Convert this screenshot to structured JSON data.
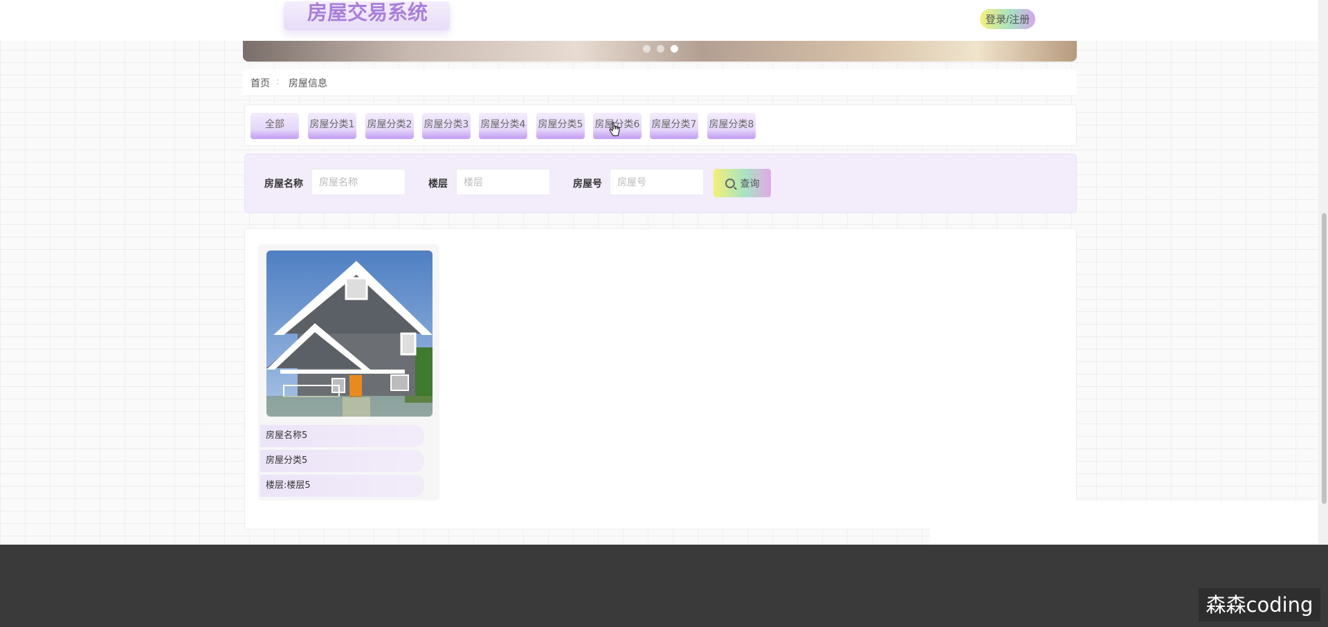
{
  "header": {
    "logo": "房屋交易系统",
    "login_label": "登录/注册"
  },
  "banner": {
    "dots": 3,
    "active_dot": 3
  },
  "breadcrumb": {
    "home": "首页",
    "separator": ":",
    "current": "房屋信息"
  },
  "categories": [
    "全部",
    "房屋分类1",
    "房屋分类2",
    "房屋分类3",
    "房屋分类4",
    "房屋分类5",
    "房屋分类6",
    "房屋分类7",
    "房屋分类8"
  ],
  "search": {
    "name_label": "房屋名称",
    "name_placeholder": "房屋名称",
    "floor_label": "楼层",
    "floor_placeholder": "楼层",
    "number_label": "房屋号",
    "number_placeholder": "房屋号",
    "button_label": "查询"
  },
  "listing": {
    "name": "房屋名称5",
    "category": "房屋分类5",
    "floor": "楼层:楼层5"
  },
  "watermark": "森森coding"
}
